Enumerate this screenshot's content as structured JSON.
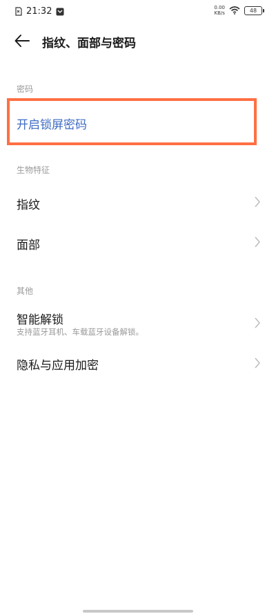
{
  "status_bar": {
    "time": "21:32",
    "net_speed_value": "0.00",
    "net_speed_unit": "KB/s",
    "battery": "48"
  },
  "header": {
    "title": "指纹、面部与密码"
  },
  "sections": {
    "password": {
      "label": "密码",
      "enable_button": "开启锁屏密码"
    },
    "biometric": {
      "label": "生物特征",
      "fingerprint": "指纹",
      "face": "面部"
    },
    "other": {
      "label": "其他",
      "smart_unlock": "智能解锁",
      "smart_unlock_desc": "支持蓝牙耳机、车载蓝牙设备解锁。",
      "privacy_encryption": "隐私与应用加密"
    }
  },
  "colors": {
    "accent_text": "#3d6bc4",
    "highlight_border": "#ff7043"
  }
}
